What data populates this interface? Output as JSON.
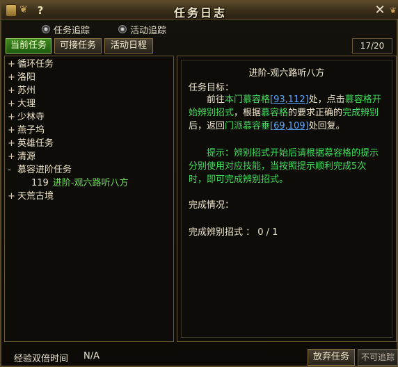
{
  "window": {
    "title": "任务日志",
    "help_glyph": "?",
    "close_glyph": "✕"
  },
  "tracking": {
    "quest_track": "任务追踪",
    "event_track": "活动追踪"
  },
  "tabs": [
    {
      "label": "当前任务",
      "active": true
    },
    {
      "label": "可接任务",
      "active": false
    },
    {
      "label": "活动日程",
      "active": false
    }
  ],
  "page_count": "17/20",
  "quest_tree": [
    {
      "expander": "+",
      "label": "循环任务"
    },
    {
      "expander": "+",
      "label": "洛阳"
    },
    {
      "expander": "+",
      "label": "苏州"
    },
    {
      "expander": "+",
      "label": "大理"
    },
    {
      "expander": "+",
      "label": "少林寺"
    },
    {
      "expander": "+",
      "label": "燕子坞"
    },
    {
      "expander": "+",
      "label": "英雄任务"
    },
    {
      "expander": "+",
      "label": "清源"
    },
    {
      "expander": "-",
      "label": "慕容进阶任务"
    },
    {
      "expander": "+",
      "label": "天荒古境"
    }
  ],
  "quest_sub": {
    "number": "119",
    "label": "进阶-观六路听八方"
  },
  "detail": {
    "title": "进阶-观六路听八方",
    "goal_label": "任务目标：",
    "goal": {
      "p1": "前往",
      "place1": "本门慕容格",
      "coord1": "[93,112]",
      "p2": "处，点击",
      "npc1": "慕容格开始辨别招式",
      "p3": "，根据",
      "npc2": "慕容格",
      "p4": "的要求正确的",
      "npc3": "完成辨别",
      "p5": "后，返回",
      "place2": "门派慕容垂",
      "coord2": "[69,109]",
      "p6": "处回复。"
    },
    "hint": "提示：辨别招式开始后请根据慕容格的提示分别使用对应技能，当按照提示顺利完成5次时，即可完成辨别招式。",
    "progress_label": "完成情况：",
    "progress_item": "完成辨别招式 ： 0 / 1"
  },
  "bottom": {
    "exp_label": "经验双倍时间",
    "exp_value": "N/A",
    "abandon_button": "放弃任务",
    "untrackable_button": "不可追踪"
  }
}
